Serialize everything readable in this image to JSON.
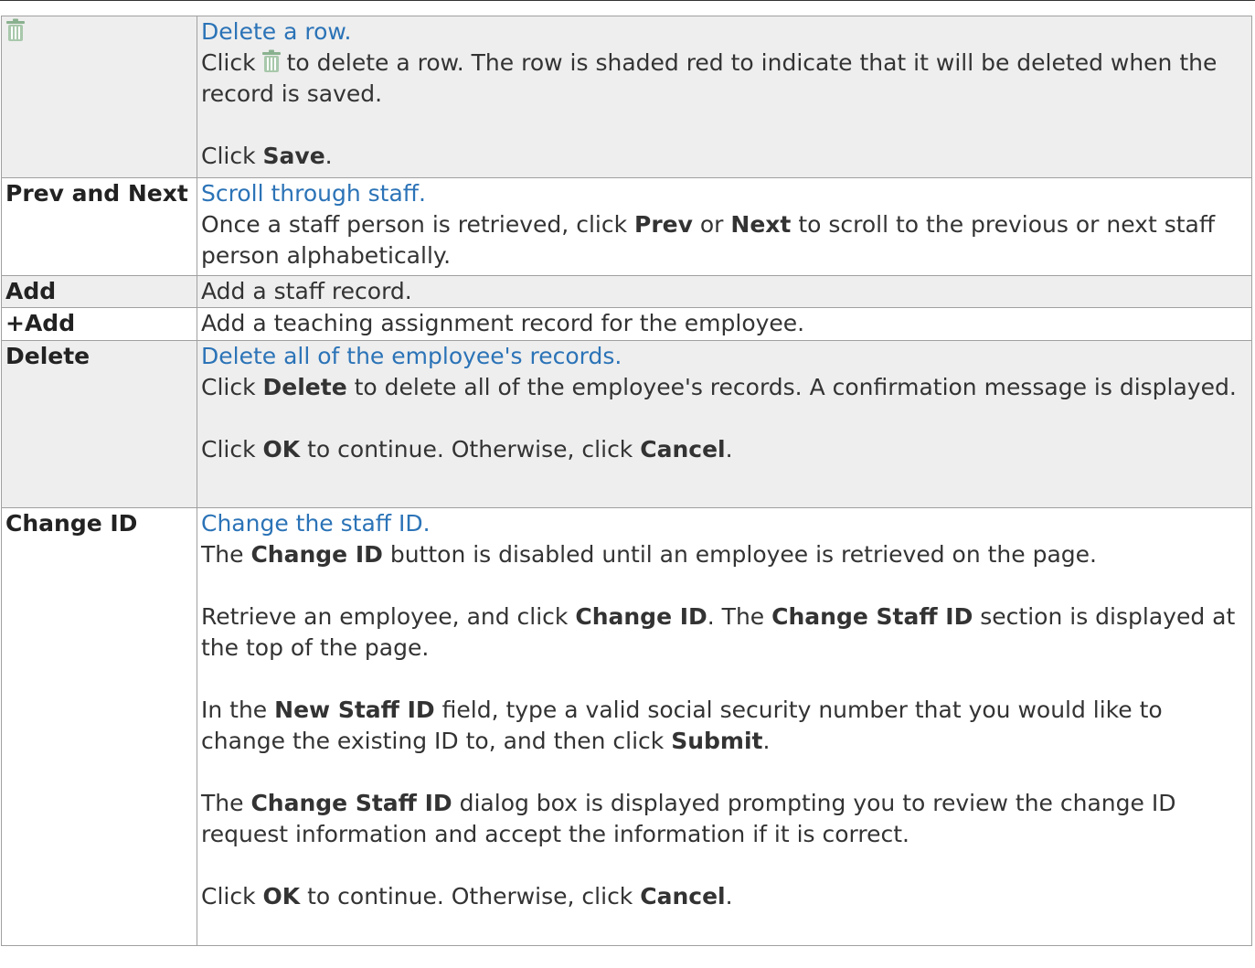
{
  "colors": {
    "link": "#2b73b7",
    "shaded_row": "#eeeeee",
    "border": "#a0a0a0",
    "trash_icon": "#8ab18f"
  },
  "rows": [
    {
      "icon": "trash-icon",
      "link": "Delete a row.",
      "text_a1": "Click",
      "text_a2": "to delete a row. The row is shaded red to indicate that it will be deleted when the record is saved.",
      "text_b1": "Click",
      "text_b2": "Save",
      "text_b3": "."
    },
    {
      "label": "Prev and Next",
      "link": "Scroll through staff.",
      "p1_a": "Once a staff person is retrieved, click",
      "p1_b": "Prev",
      "p1_c": "or",
      "p1_d": "Next",
      "p1_e": "to scroll to the previous or next staff person alphabetically."
    },
    {
      "label": "Add",
      "text": "Add a staff record."
    },
    {
      "label": "+Add",
      "text": "Add a teaching assignment record for the employee."
    },
    {
      "label": "Delete",
      "link": "Delete all of the employee's records.",
      "p1_a": "Click",
      "p1_b": "Delete",
      "p1_c": "to delete all of the employee's records. A confirmation message is displayed.",
      "p2_a": "Click",
      "p2_b": "OK",
      "p2_c": "to continue. Otherwise, click",
      "p2_d": "Cancel",
      "p2_e": "."
    },
    {
      "label": "Change ID",
      "link": "Change the staff ID.",
      "p1_a": "The",
      "p1_b": "Change ID",
      "p1_c": "button is disabled until an employee is retrieved on the page.",
      "p2_a": "Retrieve an employee, and click",
      "p2_b": "Change ID",
      "p2_c": ". The",
      "p2_d": "Change Staff ID",
      "p2_e": "section is displayed at the top of the page.",
      "p3_a": "In the",
      "p3_b": "New Staff ID",
      "p3_c": "field, type a valid social security number that you would like to change the existing ID to, and then click",
      "p3_d": "Submit",
      "p3_e": ".",
      "p4_a": "The",
      "p4_b": "Change Staff ID",
      "p4_c": "dialog box is displayed prompting you to review the change ID request information and accept the information if it is correct.",
      "p5_a": "Click",
      "p5_b": "OK",
      "p5_c": "to continue. Otherwise, click",
      "p5_d": "Cancel",
      "p5_e": "."
    }
  ]
}
